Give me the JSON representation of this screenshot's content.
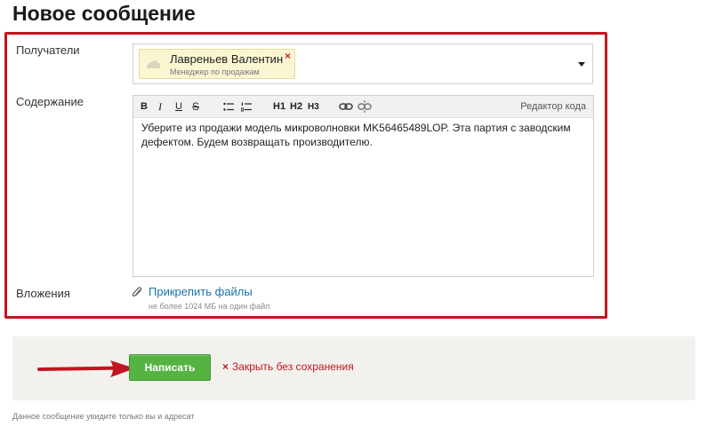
{
  "page": {
    "title": "Новое сообщение"
  },
  "form": {
    "recipients_label": "Получатели",
    "content_label": "Содержание",
    "attachments_label": "Вложения",
    "recipient": {
      "name": "Лавреньев Валентин",
      "role": "Менеджер по продажам",
      "remove_glyph": "×"
    },
    "toolbar": {
      "bold": "B",
      "italic": "I",
      "underline": "U",
      "strike": "S",
      "h1": "H1",
      "h2": "H2",
      "h3": "H3",
      "code_editor": "Редактор кода"
    },
    "message_text": "Уберите из продажи модель микроволновки MK56465489LOP. Эта партия с заводским дефектом. Будем возвращать производителю.",
    "attach_link": "Прикрепить файлы",
    "attach_hint": "не более 1024 МБ на один файл"
  },
  "actions": {
    "submit_label": "Написать",
    "close_glyph": "×",
    "close_label": "Закрыть без сохранения"
  },
  "footer": {
    "note": "Данное сообщение увидите только вы и адресат"
  },
  "colors": {
    "accent_red": "#c0161f",
    "submit_green": "#55b342",
    "link_blue": "#1a73a8",
    "chip_bg": "#fbf6d2"
  },
  "icons": [
    "avatar-icon",
    "remove-icon",
    "dropdown-icon",
    "bullet-list-icon",
    "numbered-list-icon",
    "link-icon",
    "unlink-icon",
    "paperclip-icon",
    "arrow-icon"
  ]
}
